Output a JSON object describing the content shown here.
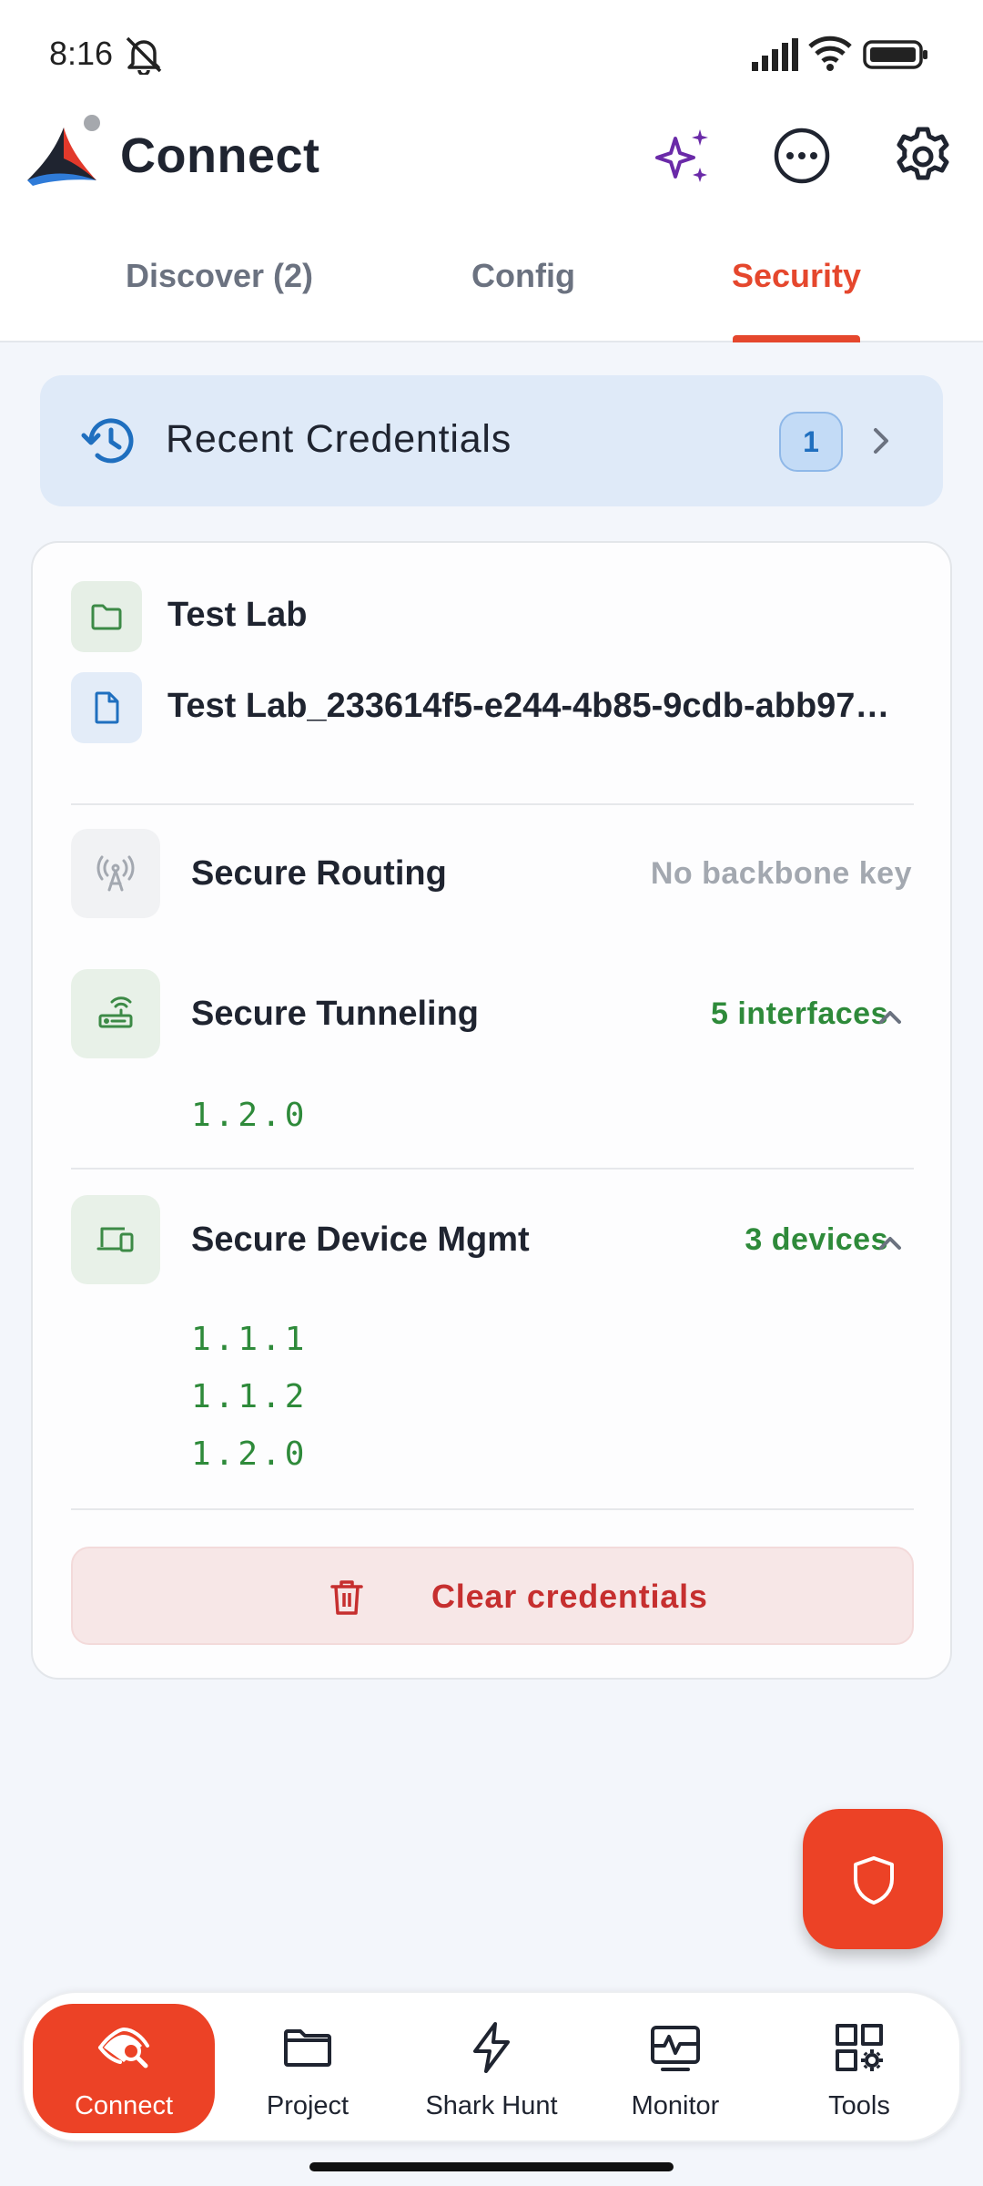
{
  "status_bar": {
    "time": "8:16"
  },
  "app": {
    "title": "Connect"
  },
  "tabs": [
    {
      "label": "Discover (2)",
      "active": false
    },
    {
      "label": "Config",
      "active": false
    },
    {
      "label": "Security",
      "active": true
    }
  ],
  "recent_credentials": {
    "label": "Recent Credentials",
    "count": "1"
  },
  "credential": {
    "project": "Test Lab",
    "file": "Test Lab_233614f5-e244-4b85-9cdb-abb97…"
  },
  "sections": [
    {
      "title": "Secure Routing",
      "value": "No backbone key",
      "versions": []
    },
    {
      "title": "Secure Tunneling",
      "value": "5 interfaces",
      "versions": [
        "1.2.0"
      ]
    },
    {
      "title": "Secure Device Mgmt",
      "value": "3 devices",
      "versions": [
        "1.1.1",
        "1.1.2",
        "1.2.0"
      ]
    }
  ],
  "clear_button": {
    "label": "Clear credentials"
  },
  "fab": {
    "icon": "shield-icon"
  },
  "bottom_nav": [
    {
      "label": "Connect",
      "icon": "connect-eye-icon",
      "active": true
    },
    {
      "label": "Project",
      "icon": "folder-icon",
      "active": false
    },
    {
      "label": "Shark Hunt",
      "icon": "lightning-icon",
      "active": false
    },
    {
      "label": "Monitor",
      "icon": "monitor-icon",
      "active": false
    },
    {
      "label": "Tools",
      "icon": "tools-icon",
      "active": false
    }
  ],
  "colors": {
    "accent": "#ec4226",
    "tab_active": "#e5472d",
    "success_green": "#2e8a3a",
    "danger_red": "#c62f2f",
    "info_blue": "#1f6fbf"
  }
}
